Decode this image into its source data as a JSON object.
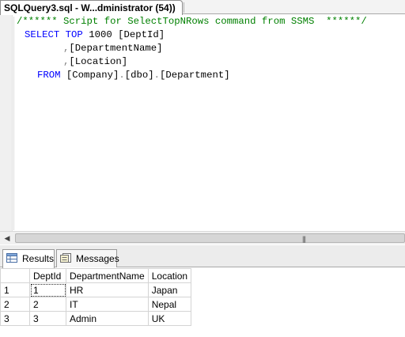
{
  "document_tab": {
    "title": "SQLQuery3.sql - W...dministrator (54))"
  },
  "editor": {
    "line1": {
      "comment": "/****** Script for SelectTopNRows command from SSMS  ******/"
    },
    "line2": {
      "select_kw": "SELECT",
      "top_kw": "TOP",
      "count": "1000",
      "column": "[DeptId]"
    },
    "line3": {
      "comma": ",",
      "column": "[DepartmentName]"
    },
    "line4": {
      "comma": ",",
      "column": "[Location]"
    },
    "line5": {
      "from_kw": "FROM",
      "table": "[Company]",
      "dot1": ".",
      "schema": "[dbo]",
      "dot2": ".",
      "object": "[Department]"
    }
  },
  "results_tabs": [
    {
      "label": "Results",
      "icon": "grid-icon",
      "active": true
    },
    {
      "label": "Messages",
      "icon": "messages-icon",
      "active": false
    }
  ],
  "results_grid": {
    "columns": [
      "DeptId",
      "DepartmentName",
      "Location"
    ],
    "rows": [
      {
        "row_number": "1",
        "DeptId": "1",
        "DepartmentName": "HR",
        "Location": "Japan"
      },
      {
        "row_number": "2",
        "DeptId": "2",
        "DepartmentName": "IT",
        "Location": "Nepal"
      },
      {
        "row_number": "3",
        "DeptId": "3",
        "DepartmentName": "Admin",
        "Location": "UK"
      }
    ]
  },
  "colors": {
    "keyword": "#0000ff",
    "comment": "#008000",
    "operator": "#808080"
  }
}
